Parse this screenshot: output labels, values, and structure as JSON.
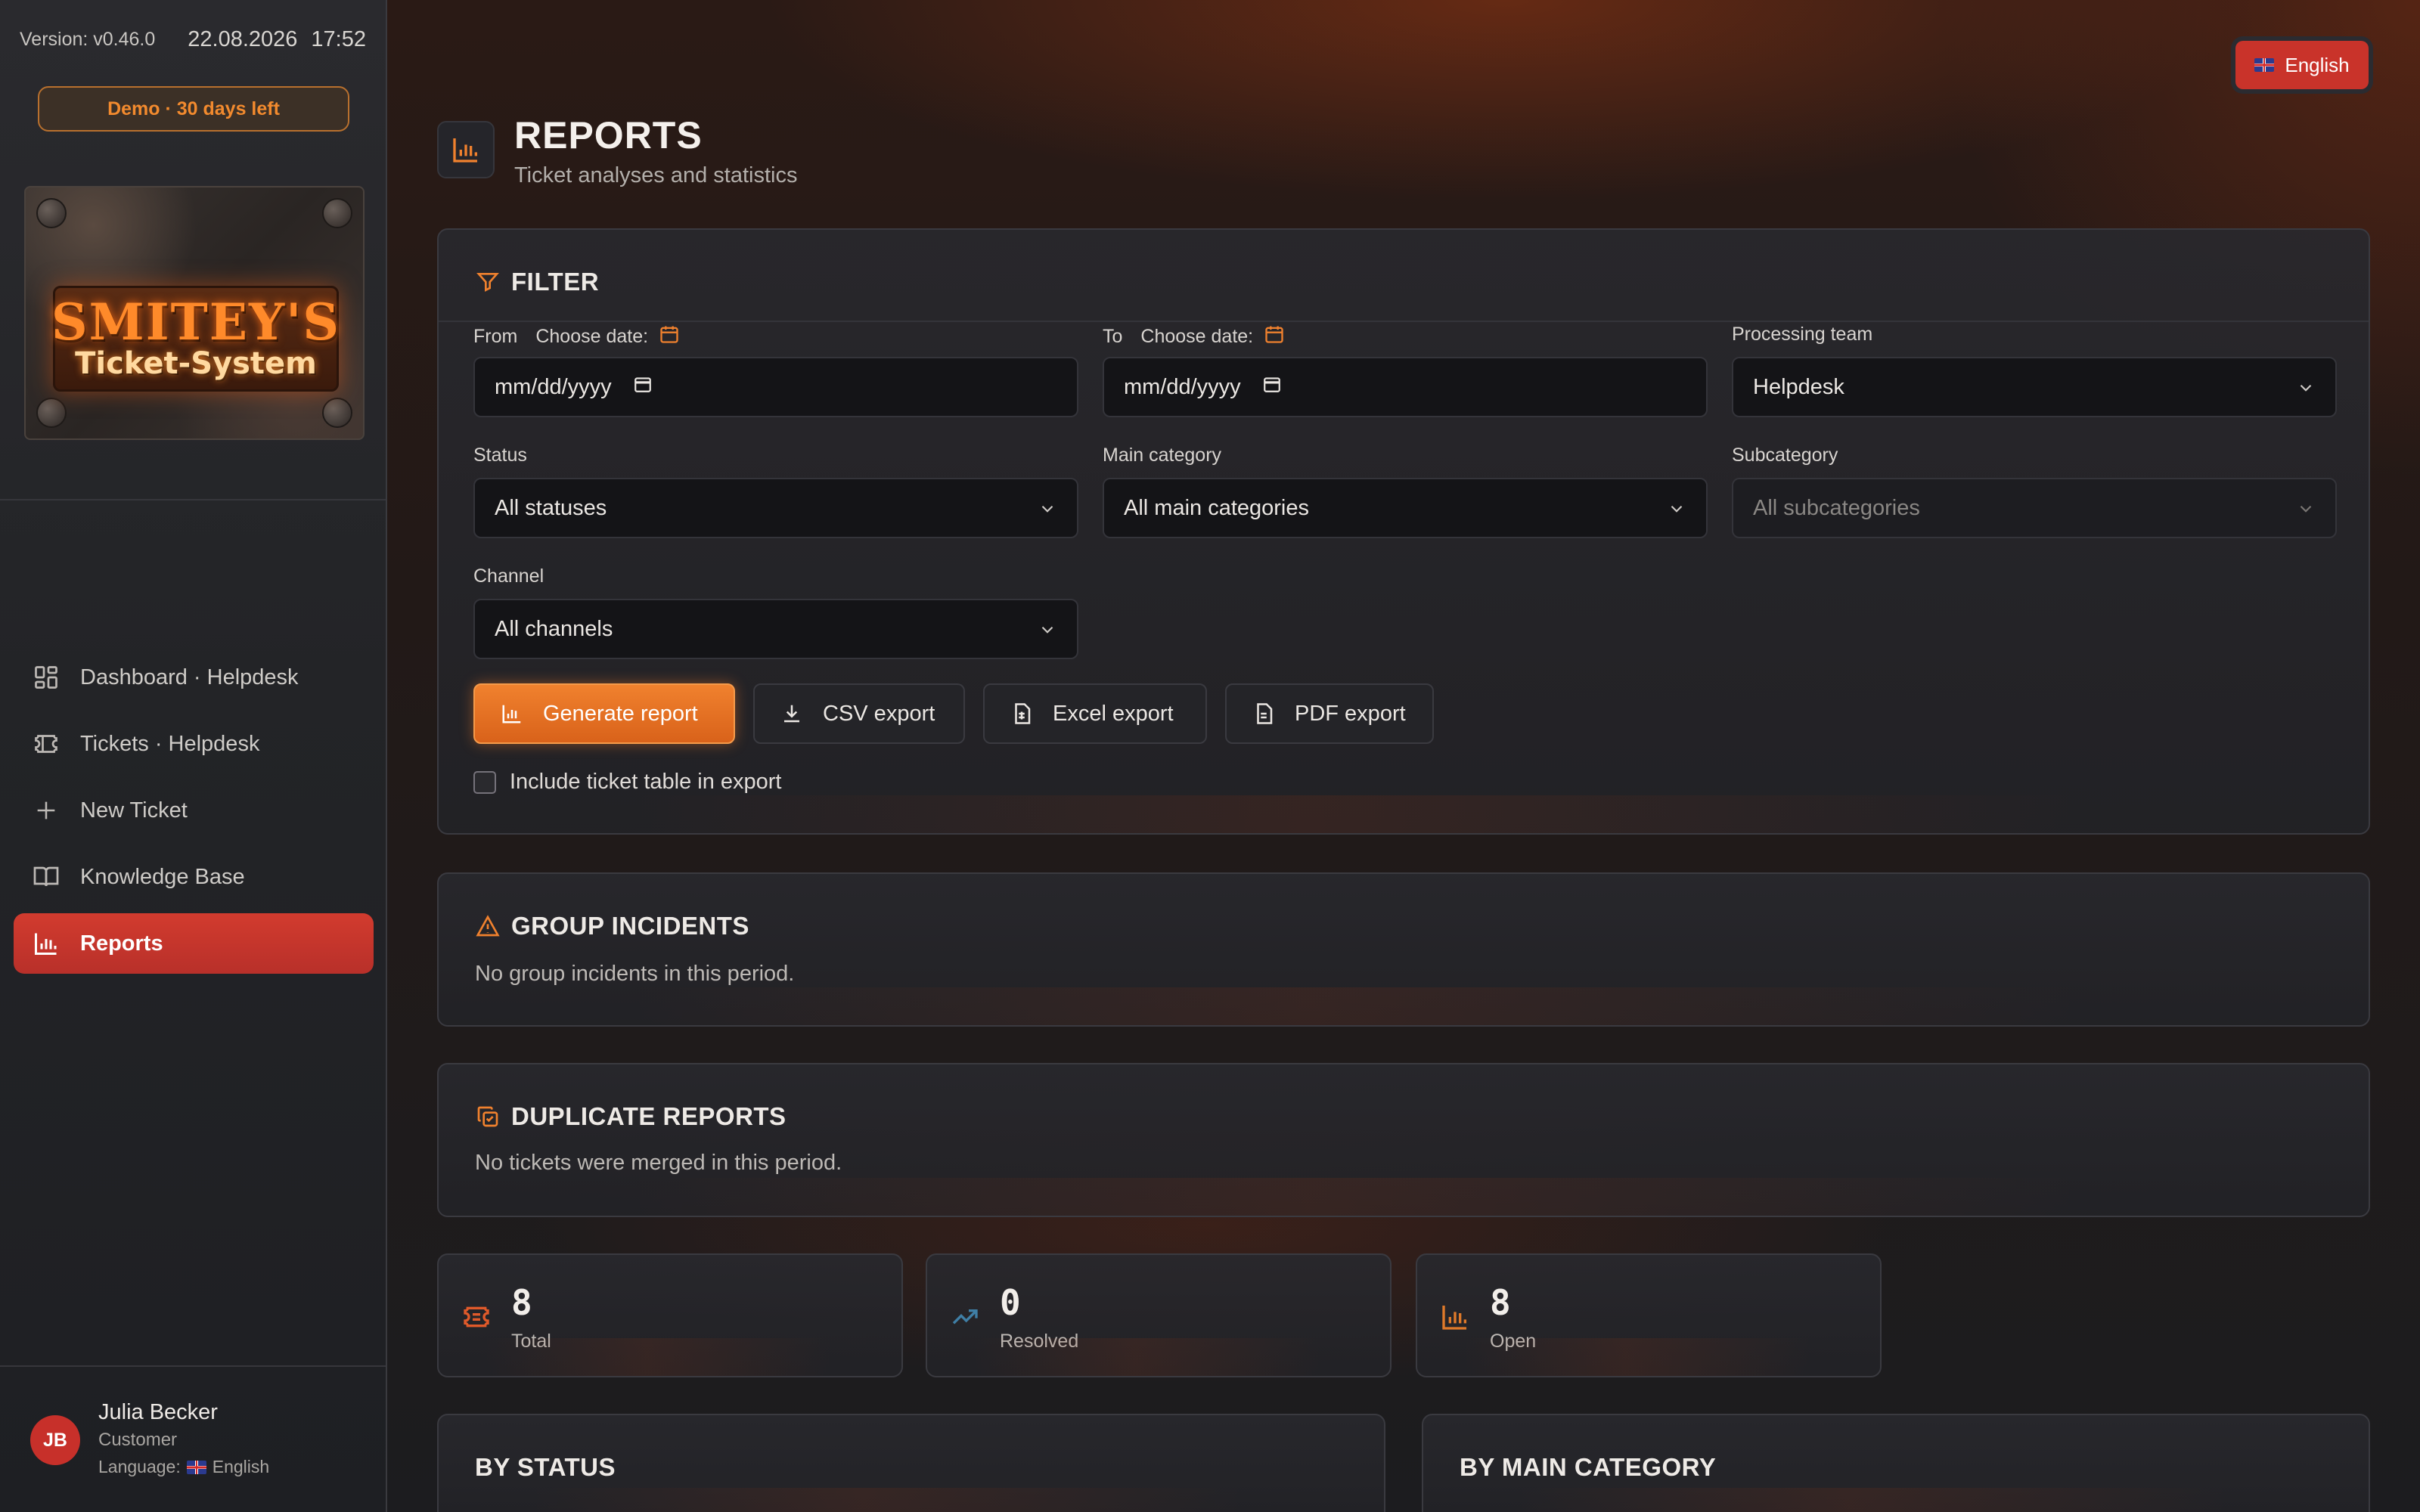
{
  "app": {
    "version": "Version: v0.46.0",
    "date": "22.08.2026",
    "time": "17:52",
    "demo_badge": "Demo · 30 days left",
    "logo_line1": "SMITEY'S",
    "logo_line2": "Ticket-System"
  },
  "sidebar": {
    "items": [
      {
        "label": "Dashboard · Helpdesk",
        "icon": "dashboard-icon",
        "active": false
      },
      {
        "label": "Tickets · Helpdesk",
        "icon": "ticket-icon",
        "active": false
      },
      {
        "label": "New Ticket",
        "icon": "plus-icon",
        "active": false
      },
      {
        "label": "Knowledge Base",
        "icon": "book-icon",
        "active": false
      },
      {
        "label": "Reports",
        "icon": "bar-chart-icon",
        "active": true
      }
    ]
  },
  "user": {
    "initials": "JB",
    "name": "Julia Becker",
    "role": "Customer",
    "language_label": "Language:",
    "language": "English"
  },
  "language_button": "English",
  "page": {
    "title": "REPORTS",
    "subtitle": "Ticket analyses and statistics"
  },
  "filter": {
    "heading": "FILTER",
    "from_label": "From",
    "to_label": "To",
    "choose_date": "Choose date:",
    "from_value": "mm/dd/yyyy",
    "to_value": "mm/dd/yyyy",
    "team_label": "Processing team",
    "team_value": "Helpdesk",
    "status_label": "Status",
    "status_value": "All statuses",
    "main_category_label": "Main category",
    "main_category_value": "All main categories",
    "subcategory_label": "Subcategory",
    "subcategory_value": "All subcategories",
    "channel_label": "Channel",
    "channel_value": "All channels",
    "buttons": {
      "generate": "Generate report",
      "csv": "CSV export",
      "excel": "Excel export",
      "pdf": "PDF export"
    },
    "include_table_label": "Include ticket table in export",
    "include_table_checked": false
  },
  "group_incidents": {
    "heading": "GROUP INCIDENTS",
    "text": "No group incidents in this period."
  },
  "duplicate_reports": {
    "heading": "DUPLICATE REPORTS",
    "text": "No tickets were merged in this period."
  },
  "stats": [
    {
      "value": "8",
      "label": "Total",
      "icon": "ticket-icon"
    },
    {
      "value": "0",
      "label": "Resolved",
      "icon": "trending-up-icon"
    },
    {
      "value": "8",
      "label": "Open",
      "icon": "bar-chart-icon"
    }
  ],
  "sections": {
    "by_status": "BY STATUS",
    "by_main_category": "BY MAIN CATEGORY"
  },
  "colors": {
    "accent_orange": "#f0812e",
    "active_red": "#c9332a",
    "icon_blue": "#3f7fa6"
  }
}
